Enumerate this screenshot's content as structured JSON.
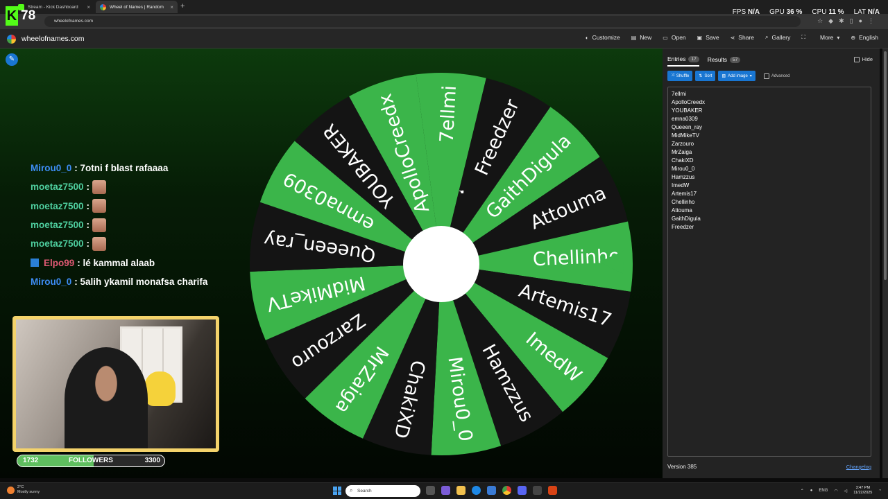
{
  "browser": {
    "tabs": [
      {
        "title": "Stream - Kick Dashboard",
        "color": "#53fc18"
      },
      {
        "title": "Wheel of Names | Random",
        "color": "#e53935"
      }
    ],
    "new_tab": "+",
    "url": "wheelofnames.com"
  },
  "overlay": {
    "kick_letter": "K",
    "viewer_count": "78",
    "stats": [
      {
        "label": "FPS",
        "value": "N/A"
      },
      {
        "label": "GPU",
        "value": "36 %"
      },
      {
        "label": "CPU",
        "value": "11 %"
      },
      {
        "label": "LAT",
        "value": "N/A"
      }
    ]
  },
  "site": {
    "name": "wheelofnames.com",
    "nav": [
      {
        "label": "Customize",
        "icon": "palette-icon",
        "glyph": "◐"
      },
      {
        "label": "New",
        "icon": "new-file-icon",
        "glyph": "▤"
      },
      {
        "label": "Open",
        "icon": "folder-icon",
        "glyph": "▭"
      },
      {
        "label": "Save",
        "icon": "save-icon",
        "glyph": "▣"
      },
      {
        "label": "Share",
        "icon": "share-icon",
        "glyph": "⋖"
      },
      {
        "label": "Gallery",
        "icon": "search-icon",
        "glyph": "⌕"
      },
      {
        "label": "",
        "icon": "fullscreen-icon",
        "glyph": "⛶"
      },
      {
        "label": "More",
        "icon": "chevron-down-icon",
        "glyph": "▾"
      },
      {
        "label": "English",
        "icon": "globe-icon",
        "glyph": "⊕"
      }
    ]
  },
  "chat": [
    {
      "user": "Mirou0_0",
      "color": "#3e8ef7",
      "text": ": 7otni f blast rafaaaa",
      "emote": false,
      "badge": false
    },
    {
      "user": "moetaz7500",
      "color": "#4fd0a0",
      "text": ":",
      "emote": true,
      "badge": false
    },
    {
      "user": "moetaz7500",
      "color": "#4fd0a0",
      "text": ":",
      "emote": true,
      "badge": false
    },
    {
      "user": "moetaz7500",
      "color": "#4fd0a0",
      "text": ":",
      "emote": true,
      "badge": false
    },
    {
      "user": "moetaz7500",
      "color": "#4fd0a0",
      "text": ":",
      "emote": true,
      "badge": false
    },
    {
      "user": "Elpo99",
      "color": "#e05a74",
      "text": ": lé kammal alaab",
      "emote": false,
      "badge": true
    },
    {
      "user": "Mirou0_0",
      "color": "#3e8ef7",
      "text": ": 5alih ykamil monafsa charifa",
      "emote": false,
      "badge": false
    }
  ],
  "followers": {
    "current": "1732",
    "label": "FOLLOWERS",
    "goal": "3300",
    "progress": 0.52
  },
  "wheel": {
    "colors": [
      "#3bb54a",
      "#141414"
    ],
    "text_colors": [
      "#ffffff",
      "#ffffff"
    ],
    "pointer_color": "#3bb54a",
    "segments": [
      "7ellmi",
      "Freedzer",
      "GaithDigula",
      "Attouma",
      "Chellinho",
      "Artemis17",
      "ImedW",
      "Hamzzus",
      "Mirou0_0",
      "ChakiXD",
      "MrZaiga",
      "Zarzouro",
      "MidMikeTV",
      "Queeen_ray",
      "emna0309",
      "YOUBAKER",
      "ApolloCreedx"
    ]
  },
  "panel": {
    "tabs": [
      {
        "label": "Entries",
        "count": "17"
      },
      {
        "label": "Results",
        "count": "57"
      }
    ],
    "hide_label": "Hide",
    "tools": [
      {
        "label": "Shuffle",
        "icon": "shuffle-icon",
        "glyph": "⤨"
      },
      {
        "label": "Sort",
        "icon": "sort-icon",
        "glyph": "⇅"
      },
      {
        "label": "Add image",
        "icon": "image-icon",
        "glyph": "▧"
      }
    ],
    "advanced_label": "Advanced",
    "entries": [
      "7ellmi",
      "ApolloCreedx",
      "YOUBAKER",
      "emna0309",
      "Queeen_ray",
      "MidMikeTV",
      "Zarzouro",
      "MrZaiga",
      "ChakiXD",
      "Mirou0_0",
      "Hamzzus",
      "ImedW",
      "Artemis17",
      "Chellinho",
      "Attouma",
      "GaithDigula",
      "Freedzer"
    ],
    "version": "Version 385",
    "changelog": "Changelog"
  },
  "taskbar": {
    "weather_temp": "2°C",
    "weather_text": "Mostly sunny",
    "search_placeholder": "Search",
    "lang": "ENG",
    "time": "3:47 PM",
    "date": "11/22/2025"
  }
}
